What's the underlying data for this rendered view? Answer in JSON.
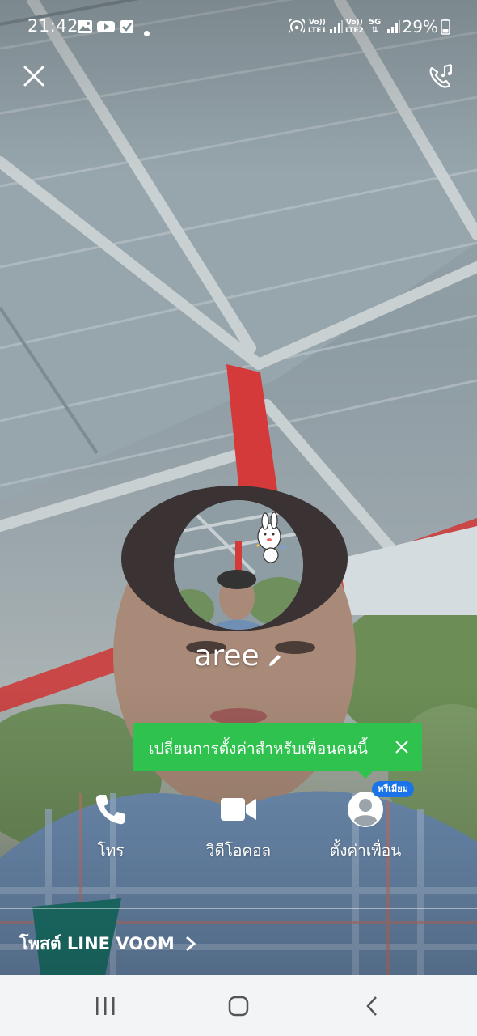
{
  "status_bar": {
    "time": "21:42",
    "notification_icons": [
      "image-icon",
      "youtube-icon",
      "checkbox-icon",
      "dot-icon"
    ],
    "sim1_label_top": "Vo))",
    "sim1_label_bottom": "LTE1",
    "sim2_label_top": "Vo))",
    "sim2_label_bottom": "LTE2",
    "network_type": "5G",
    "battery_percent": "29%"
  },
  "top_bar": {
    "close_icon": "close-icon",
    "call_music_icon": "phone-music-icon"
  },
  "profile": {
    "name": "aree",
    "edit_icon": "pencil-icon"
  },
  "tooltip": {
    "text": "เปลี่ยนการตั้งค่าสำหรับเพื่อนคนนี้",
    "color": "#2fc24f"
  },
  "actions": [
    {
      "label": "โทร",
      "icon": "phone-icon"
    },
    {
      "label": "วิดีโอคอล",
      "icon": "video-camera-icon"
    },
    {
      "label": "ตั้งค่าเพื่อน",
      "icon": "friend-settings-icon",
      "badge": "พรีเมียม"
    }
  ],
  "voom": {
    "label": "โพสต์ LINE VOOM"
  },
  "colors": {
    "accent_green": "#2fc24f",
    "premium_blue": "#1a73e8",
    "nav_background": "#f3f4f6"
  }
}
